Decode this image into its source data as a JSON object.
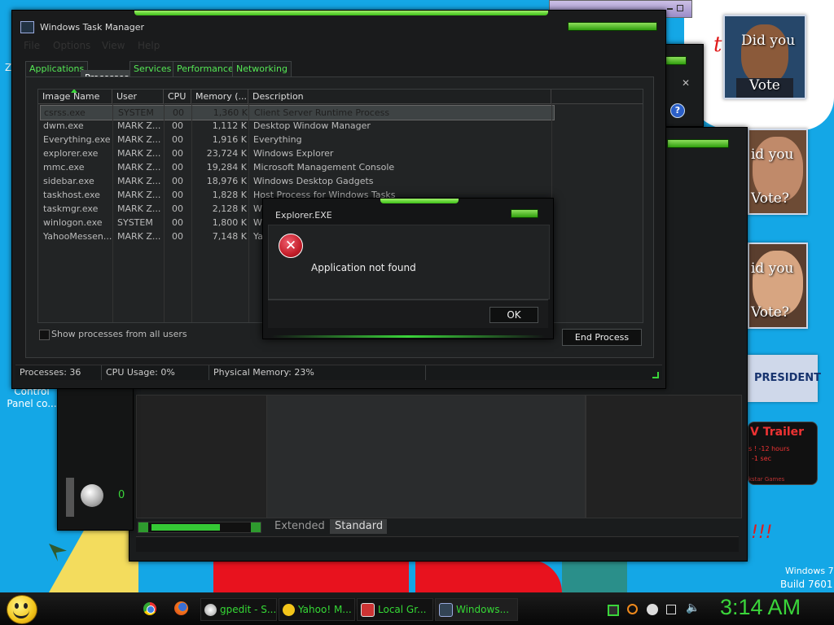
{
  "desktop": {
    "icon_label_line1": "Control",
    "icon_label_line2": "Panel co...",
    "build_line1": "Windows 7",
    "build_line2": "Build 7601",
    "gadget_left_char": "Z",
    "poster1_line1": "Did you",
    "poster1_line2": "Vote",
    "poster2_line1": "id you",
    "poster2_line2": "Vote?",
    "poster3_line1": "id you",
    "poster3_line2": "Vote?",
    "president_banner": "PRESIDENT",
    "trailer_title": "V Trailer",
    "trailer_line1": "s ! -12 hours",
    "trailer_line2": "-1 sec",
    "trailer_footer": "kstar Games",
    "exclaim": "!!!",
    "red_text_t": "t"
  },
  "task_manager": {
    "title": "Windows Task Manager",
    "menu": [
      "File",
      "Options",
      "View",
      "Help"
    ],
    "tabs": [
      "Applications",
      "Processes",
      "Services",
      "Performance",
      "Networking"
    ],
    "active_tab": "Processes",
    "columns": [
      "Image Name",
      "User Name",
      "CPU",
      "Memory (...",
      "Description"
    ],
    "rows": [
      {
        "name": "csrss.exe",
        "user": "SYSTEM",
        "cpu": "00",
        "mem": "1,360 K",
        "desc": "Client Server Runtime Process"
      },
      {
        "name": "dwm.exe",
        "user": "MARK Z...",
        "cpu": "00",
        "mem": "1,112 K",
        "desc": "Desktop Window Manager"
      },
      {
        "name": "Everything.exe",
        "user": "MARK Z...",
        "cpu": "00",
        "mem": "1,916 K",
        "desc": "Everything"
      },
      {
        "name": "explorer.exe",
        "user": "MARK Z...",
        "cpu": "00",
        "mem": "23,724 K",
        "desc": "Windows Explorer"
      },
      {
        "name": "mmc.exe",
        "user": "MARK Z...",
        "cpu": "00",
        "mem": "19,284 K",
        "desc": "Microsoft Management Console"
      },
      {
        "name": "sidebar.exe",
        "user": "MARK Z...",
        "cpu": "00",
        "mem": "18,976 K",
        "desc": "Windows Desktop Gadgets"
      },
      {
        "name": "taskhost.exe",
        "user": "MARK Z...",
        "cpu": "00",
        "mem": "1,828 K",
        "desc": "Host Process for Windows Tasks"
      },
      {
        "name": "taskmgr.exe",
        "user": "MARK Z...",
        "cpu": "00",
        "mem": "2,128 K",
        "desc": "W"
      },
      {
        "name": "winlogon.exe",
        "user": "SYSTEM",
        "cpu": "00",
        "mem": "1,800 K",
        "desc": "W"
      },
      {
        "name": "YahooMessen...",
        "user": "MARK Z...",
        "cpu": "00",
        "mem": "7,148 K",
        "desc": "Ya"
      }
    ],
    "show_all_label": "Show processes from all users",
    "end_process_label": "End Process",
    "status": {
      "processes": "Processes: 36",
      "cpu": "CPU Usage: 0%",
      "memory": "Physical Memory: 23%"
    }
  },
  "dialog": {
    "title": "Explorer.EXE",
    "message": "Application not found",
    "ok_label": "OK"
  },
  "back_window": {
    "counter": "0",
    "view_tabs": [
      "Extended",
      "Standard"
    ]
  },
  "taskbar": {
    "items": [
      {
        "label": "gpedit - S...",
        "icon": "gpedit-icon"
      },
      {
        "label": "Yahoo! M...",
        "icon": "yahoo-smiley-icon"
      },
      {
        "label": "Local Gr...",
        "icon": "local-group-icon"
      },
      {
        "label": "Windows...",
        "icon": "task-manager-icon"
      }
    ],
    "clock": "3:14 AM"
  },
  "colors": {
    "accent_green": "#3ad53a",
    "desktop_blue": "#14a7e6",
    "window_dark": "#1b1d1e",
    "error_red": "#c41e2a"
  }
}
